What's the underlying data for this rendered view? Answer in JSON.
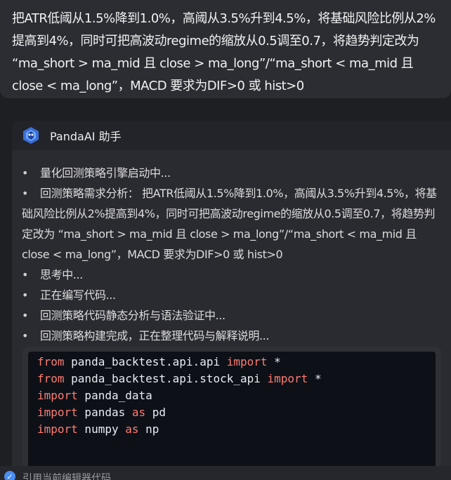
{
  "user_message": {
    "text": "把ATR低阈从1.5%降到1.0%，高阈从3.5%升到4.5%，将基础风险比例从2%提高到4%，同时可把高波动regime的缩放从0.5调至0.7，将趋势判定改为 “ma_short > ma_mid 且 close > ma_long”/“ma_short < ma_mid 且 close < ma_long”，MACD 要求为DIF>0 或 hist>0"
  },
  "assistant": {
    "name": "PandaAI 助手",
    "logo_icon": "panda-ai-logo-icon",
    "status_items": [
      "量化回测策略引擎启动中...",
      "回测策略需求分析： 把ATR低阈从1.5%降到1.0%，高阈从3.5%升到4.5%，将基础风险比例从2%提高到4%，同时可把高波动regime的缩放从0.5调至0.7，将趋势判定改为 “ma_short > ma_mid 且 close > ma_long”/“ma_short < ma_mid 且 close < ma_long”，MACD 要求为DIF>0 或 hist>0",
      "思考中...",
      "正在编写代码...",
      "回测策略代码静态分析与语法验证中...",
      "回测策略构建完成，正在整理代码与解释说明..."
    ],
    "code": [
      {
        "kw": "from",
        "rest": " panda_backtest.api.api ",
        "kw2": "import",
        "tail": " *"
      },
      {
        "kw": "from",
        "rest": " panda_backtest.api.stock_api ",
        "kw2": "import",
        "tail": " *"
      },
      {
        "kw": "import",
        "rest": " panda_data",
        "kw2": "",
        "tail": ""
      },
      {
        "kw": "import",
        "rest": " pandas ",
        "kw2": "as",
        "tail": " pd"
      },
      {
        "kw": "import",
        "rest": " numpy ",
        "kw2": "as",
        "tail": " np"
      }
    ]
  },
  "bottom": {
    "label": "引用当前编辑器代码",
    "icon": "check-icon"
  },
  "colors": {
    "keyword": "#ff7b72",
    "code_bg": "#0d1117",
    "accent": "#4a8cf0"
  }
}
